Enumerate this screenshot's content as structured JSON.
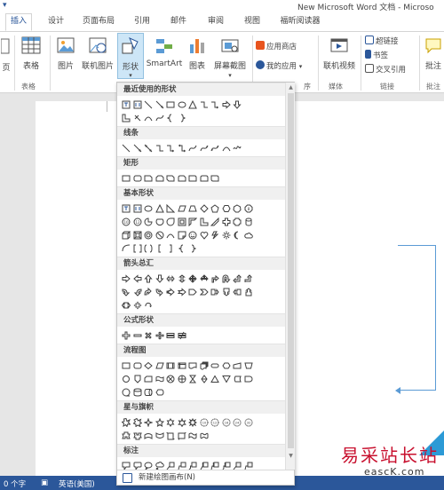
{
  "window": {
    "title": "New Microsoft Word 文档 - Microso",
    "quick_access": "▾"
  },
  "tabs": [
    "插入",
    "设计",
    "页面布局",
    "引用",
    "邮件",
    "审阅",
    "视图",
    "福昕阅读器"
  ],
  "ribbon": {
    "cut_label": "页",
    "table_label": "表格",
    "picture_label": "图片",
    "online_picture_label": "联机图片",
    "shapes_label": "形状",
    "smartart_label": "SmartArt",
    "chart_label": "图表",
    "screenshot_label": "屏幕截图",
    "store_label": "应用商店",
    "myapps_label": "我的应用",
    "online_video_label": "联机视频",
    "hyperlink_label": "超链接",
    "bookmark_label": "书签",
    "crossref_label": "交叉引用",
    "comment_label": "批注",
    "groups": {
      "tables": "表格",
      "apps": "序",
      "media": "媒体",
      "links": "链接",
      "comments": "批注"
    }
  },
  "shapes_menu": {
    "sections": [
      {
        "title": "最近使用的形状",
        "rows": [
          [
            "textbox",
            "textbox-v",
            "line",
            "line2",
            "rect",
            "oval",
            "triangle",
            "elbow",
            "elbow2",
            "rarrow",
            "darrow"
          ],
          [
            "lshape",
            "ltext",
            "arc",
            "curve",
            "brace-l",
            "brace-r"
          ]
        ]
      },
      {
        "title": "线条",
        "rows": [
          [
            "line",
            "arrowline",
            "dblarrow",
            "elbow",
            "elbowarrow",
            "elbowdbl",
            "curve",
            "curvearrow",
            "curvedbl",
            "arc",
            "scribble"
          ]
        ]
      },
      {
        "title": "矩形",
        "rows": [
          [
            "rect",
            "roundrect",
            "snip1",
            "snip2",
            "snip3",
            "roundsnip",
            "round1",
            "round2",
            "round3"
          ]
        ]
      },
      {
        "title": "基本形状",
        "rows": [
          [
            "textbox",
            "textbox-v",
            "oval",
            "triangle",
            "rtriangle",
            "parallelogram",
            "trapezoid",
            "diamond",
            "pentagon",
            "hexagon",
            "heptagon",
            "octagon"
          ],
          [
            "decagon",
            "dodecagon",
            "pie",
            "chord",
            "teardrop",
            "frame",
            "halfframe",
            "lshape",
            "diag",
            "cross",
            "plaque",
            "can"
          ],
          [
            "cube",
            "bevel",
            "donut",
            "nosymbol",
            "arc",
            "folded",
            "smiley",
            "heart",
            "bolt",
            "sun",
            "moon",
            "cloud"
          ],
          [
            "arc2",
            "bracketpair",
            "bracepair",
            "bracket-l",
            "bracket-r",
            "brace-l",
            "brace-r"
          ]
        ]
      },
      {
        "title": "箭头总汇",
        "rows": [
          [
            "rarrow",
            "larrow",
            "uarrow",
            "darrow",
            "lrarrow",
            "udarrow",
            "quadarrow",
            "lrudarrow",
            "bentarrow",
            "uturn",
            "luarrow",
            "bentup"
          ],
          [
            "curvedr",
            "curvedl",
            "curvedu",
            "curvedd",
            "striped",
            "notched",
            "pentagonarr",
            "chevron",
            "rcallout",
            "dcallout",
            "lcallout",
            "ucallout"
          ],
          [
            "lrcallout",
            "quadcallout",
            "circarrow"
          ]
        ]
      },
      {
        "title": "公式形状",
        "rows": [
          [
            "plus",
            "minus",
            "mult",
            "div",
            "equal",
            "notequal"
          ]
        ]
      },
      {
        "title": "流程图",
        "rows": [
          [
            "process",
            "altprocess",
            "decision",
            "data",
            "predef",
            "intstorage",
            "document",
            "multidoc",
            "terminator",
            "preparation",
            "manual",
            "manualop"
          ],
          [
            "connector",
            "offpage",
            "card",
            "punched",
            "sumjunction",
            "or",
            "collate",
            "sort",
            "extract",
            "merge",
            "stored",
            "delay"
          ],
          [
            "seqaccess",
            "magdisk",
            "direct",
            "display"
          ]
        ]
      },
      {
        "title": "星与旗帜",
        "rows": [
          [
            "exp1",
            "exp2",
            "star4",
            "star5",
            "star6",
            "star7",
            "star8",
            "star10",
            "star12",
            "star16",
            "star24",
            "star32"
          ],
          [
            "ribbonup",
            "ribbondown",
            "curvedup",
            "curveddown",
            "vscroll",
            "hscroll",
            "wave",
            "dwave"
          ]
        ]
      },
      {
        "title": "标注",
        "rows": [
          [
            "rectcall",
            "roundcall",
            "ovalcall",
            "cloudcall",
            "line1",
            "line2c",
            "line3",
            "accent1",
            "accent2",
            "accent3",
            "border1",
            "border2"
          ]
        ]
      }
    ],
    "new_canvas_label": "新建绘图画布(N)"
  },
  "status": {
    "words": "0 个字",
    "language": "英语(美国)"
  },
  "watermark": {
    "text": "易采站长站",
    "url": "eascK.com"
  },
  "colors": {
    "accent": "#2b579a",
    "connector": "#5b9bd5",
    "shape_stroke": "#404040",
    "active_button": "#cde6f7"
  }
}
